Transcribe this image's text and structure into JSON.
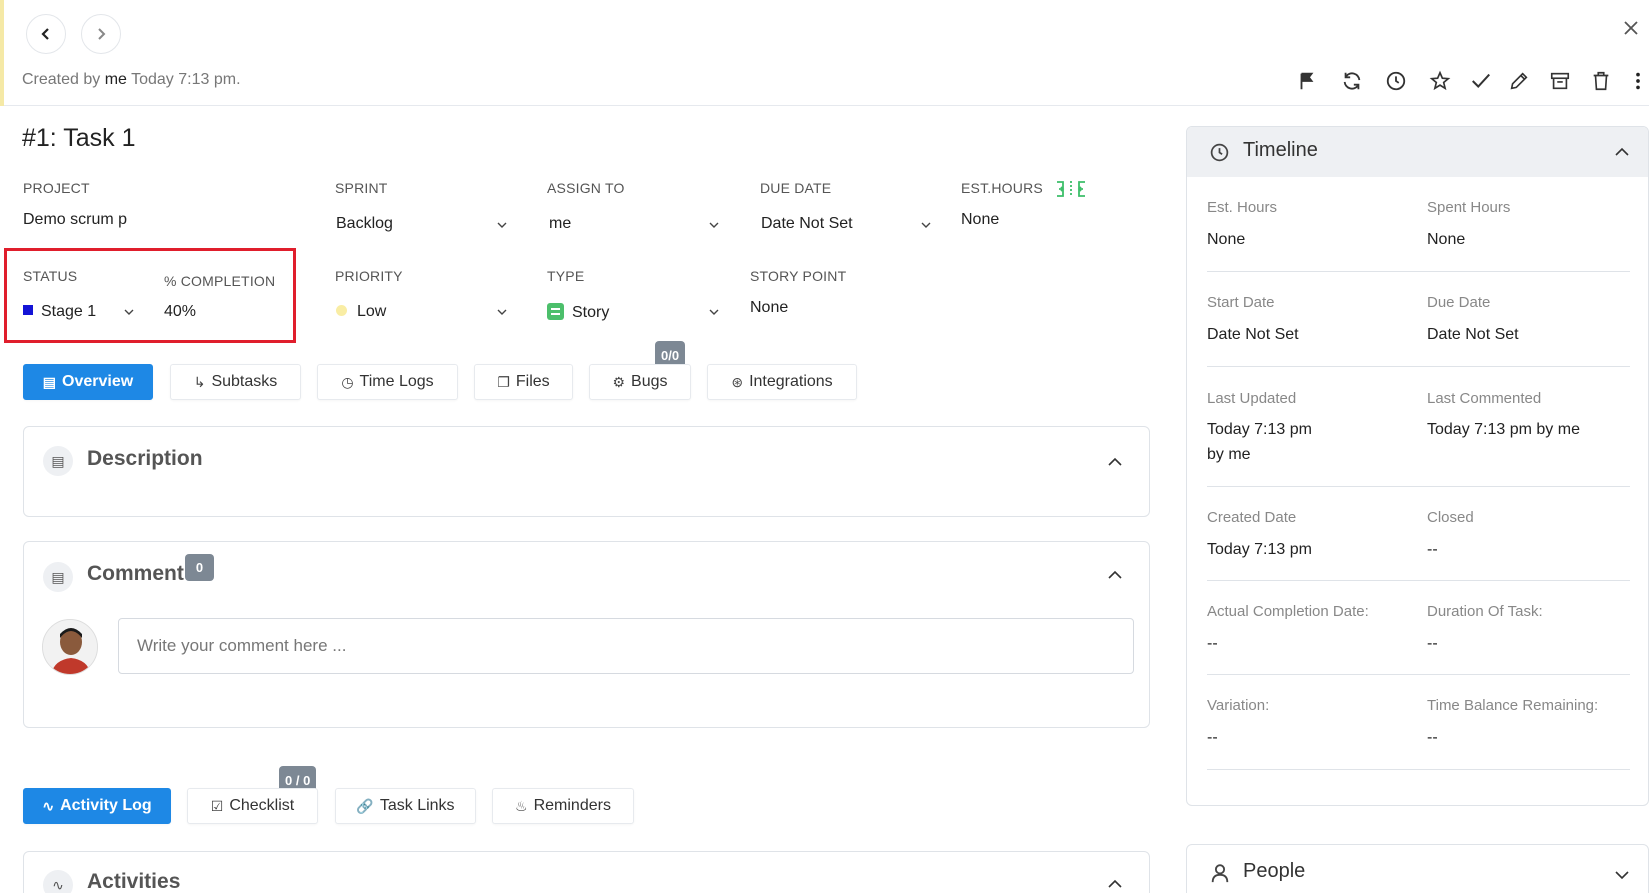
{
  "header": {
    "back_icon": "chevron-left-icon",
    "forward_icon": "chevron-right-icon",
    "created_prefix": "Created by",
    "created_user": "me",
    "created_time": "Today 7:13 pm.",
    "close_icon": "close-icon",
    "toolbar_icons": [
      "flag-icon",
      "refresh-icon",
      "clock-icon",
      "star-icon",
      "check-icon",
      "pencil-icon",
      "archive-icon",
      "trash-icon",
      "more-vertical-icon"
    ]
  },
  "task": {
    "title": "#1: Task 1",
    "project_label": "PROJECT",
    "project_value": "Demo scrum p",
    "sprint_label": "SPRINT",
    "sprint_value": "Backlog",
    "assign_label": "ASSIGN TO",
    "assign_value": "me",
    "due_label": "DUE DATE",
    "due_value": "Date Not Set",
    "est_label": "EST.HOURS",
    "est_value": "None",
    "status_label": "STATUS",
    "status_value": "Stage 1",
    "status_color": "#1414d6",
    "completion_label": "% COMPLETION",
    "completion_value": "40%",
    "priority_label": "PRIORITY",
    "priority_value": "Low",
    "type_label": "TYPE",
    "type_value": "Story",
    "storypoint_label": "STORY POINT",
    "storypoint_value": "None"
  },
  "tabs": {
    "overview": "Overview",
    "subtasks": "Subtasks",
    "timelogs": "Time Logs",
    "files": "Files",
    "bugs": "Bugs",
    "bugs_badge": "0/0",
    "integrations": "Integrations"
  },
  "description": {
    "title": "Description"
  },
  "comment": {
    "title": "Comment",
    "count": "0",
    "placeholder": "Write your comment here ..."
  },
  "bottom_tabs": {
    "activity": "Activity Log",
    "checklist": "Checklist",
    "checklist_badge": "0 / 0",
    "tasklinks": "Task Links",
    "reminders": "Reminders"
  },
  "activities": {
    "title": "Activities"
  },
  "timeline": {
    "title": "Timeline",
    "rows": [
      {
        "l1": "Est. Hours",
        "v1": "None",
        "l2": "Spent Hours",
        "v2": "None"
      },
      {
        "l1": "Start Date",
        "v1": "Date Not Set",
        "l2": "Due Date",
        "v2": "Date Not Set"
      },
      {
        "l1": "Last Updated",
        "v1": "Today 7:13 pm",
        "v1b": "by me",
        "l2": "Last Commented",
        "v2": "Today 7:13 pm by me"
      },
      {
        "l1": "Created Date",
        "v1": "Today 7:13 pm",
        "l2": "Closed",
        "v2": "--"
      },
      {
        "l1": "Actual Completion Date:",
        "v1": "--",
        "l2": "Duration Of Task:",
        "v2": "--"
      },
      {
        "l1": "Variation:",
        "v1": "--",
        "l2": "Time Balance Remaining:",
        "v2": "--"
      }
    ]
  },
  "people": {
    "title": "People"
  },
  "colors": {
    "accent": "#1e88e5",
    "highlight": "#e01e2c",
    "badge": "#7d8894"
  }
}
